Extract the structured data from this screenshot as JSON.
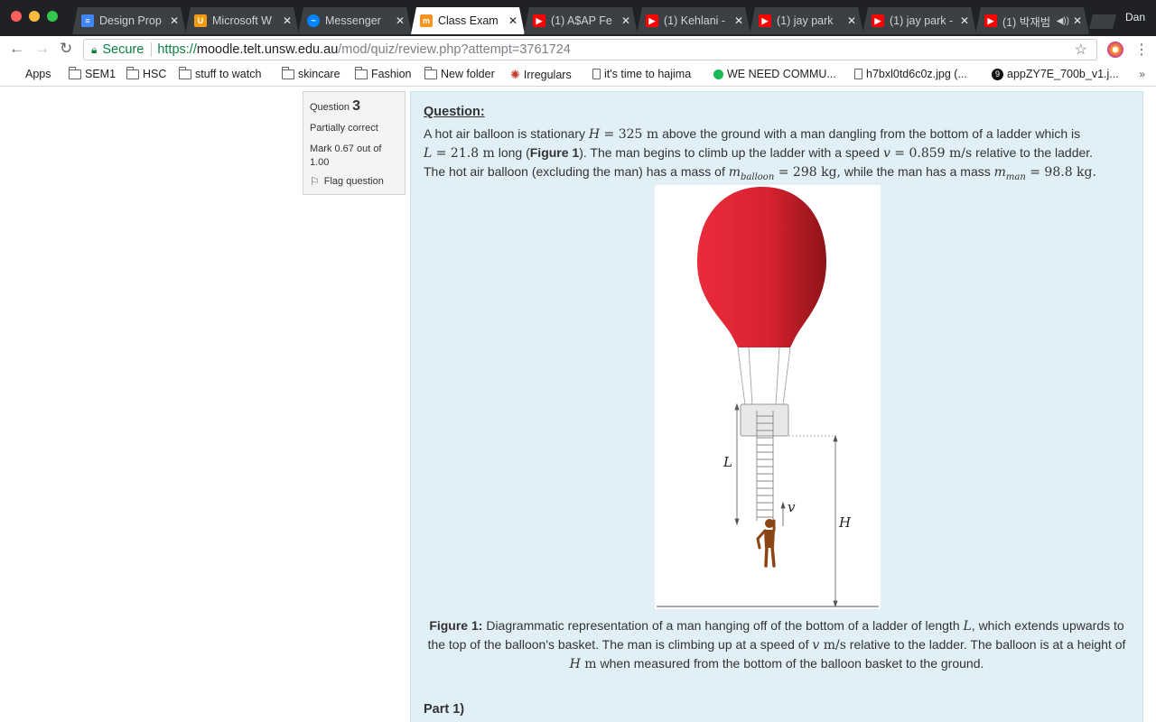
{
  "browser": {
    "tabs": [
      {
        "title": "Design Prop",
        "favicon": "docs-icon",
        "color": "#4285f4",
        "active": false
      },
      {
        "title": "Microsoft W",
        "favicon": "microsoft-icon",
        "color": "#f39c12",
        "active": false
      },
      {
        "title": "Messenger",
        "favicon": "messenger-icon",
        "color": "#0084ff",
        "active": false
      },
      {
        "title": "Class Exam",
        "favicon": "moodle-icon",
        "color": "#f7931e",
        "active": true
      },
      {
        "title": "(1) A$AP Fe",
        "favicon": "youtube-icon",
        "color": "#ff0000",
        "active": false
      },
      {
        "title": "(1) Kehlani -",
        "favicon": "youtube-icon",
        "color": "#ff0000",
        "active": false
      },
      {
        "title": "(1) jay park",
        "favicon": "youtube-icon",
        "color": "#ff0000",
        "active": false
      },
      {
        "title": "(1) jay park -",
        "favicon": "youtube-icon",
        "color": "#ff0000",
        "active": false
      },
      {
        "title": "(1) 박재범",
        "favicon": "youtube-icon",
        "color": "#ff0000",
        "active": false
      }
    ],
    "user": "Dan",
    "secure_label": "Secure",
    "url": {
      "scheme": "https://",
      "host": "moodle.telt.unsw.edu.au",
      "path": "/mod/quiz/review.php?attempt=3761724"
    },
    "bookmarks": [
      {
        "label": "Apps",
        "icon": "apps-grid-icon"
      },
      {
        "label": "SEM1",
        "icon": "folder-icon"
      },
      {
        "label": "HSC",
        "icon": "folder-icon"
      },
      {
        "label": "stuff to watch",
        "icon": "folder-icon"
      },
      {
        "label": "skincare",
        "icon": "folder-icon"
      },
      {
        "label": "Fashion",
        "icon": "folder-icon"
      },
      {
        "label": "New folder",
        "icon": "folder-icon"
      },
      {
        "label": "Irregulars",
        "icon": "irregulars-icon"
      },
      {
        "label": "it's time to hajima",
        "icon": "page-icon"
      },
      {
        "label": "WE NEED COMMU...",
        "icon": "green-dot-icon"
      },
      {
        "label": "h7bxl0td6c0z.jpg (...",
        "icon": "page-icon"
      },
      {
        "label": "appZY7E_700b_v1.j...",
        "icon": "9gag-icon"
      }
    ]
  },
  "question_info": {
    "label": "Question",
    "number": "3",
    "state": "Partially correct",
    "mark": "Mark 0.67 out of 1.00",
    "flag": "Flag question"
  },
  "question": {
    "heading": "Question:",
    "text": {
      "t1": "A hot air balloon is stationary ",
      "H": "H",
      "eq1": " = 325 m",
      "t2": " above the ground with a man dangling from the bottom of a ladder which is",
      "L": "L",
      "eq2": " = 21.8 m",
      "t3": " long (",
      "figref": "Figure 1",
      "t4": "). The man begins to climb up the ladder with a speed ",
      "v": "v",
      "eq3": " = 0.859 m/s",
      "t5": " relative to the ladder.",
      "t6": "The hot air balloon (excluding the man) has a mass of ",
      "mb": "m",
      "mb_sub": "balloon",
      "eq4": " = 298 kg,",
      "t7": " while the man has a mass ",
      "mm": "m",
      "mm_sub": "man",
      "eq5": " = 98.8 kg."
    },
    "figure_labels": {
      "L": "L",
      "v": "v",
      "H": "H"
    },
    "caption": {
      "label": "Figure 1:",
      "c1": " Diagrammatic representation of a man hanging off of the bottom of a ladder of length ",
      "L": "L",
      "c2": ", which extends upwards to the top of the balloon's basket. The man is climbing up at a speed of ",
      "v": "v",
      "unit1": " m/s",
      "c3": " relative to the ladder. The balloon is at a height of ",
      "H": "H",
      "unit2": " m",
      "c4": " when measured from the bottom of the balloon basket to the ground."
    },
    "part": "Part 1)"
  },
  "colors": {
    "balloon": "#d8222f",
    "man": "#8b4513",
    "question_bg": "#e1eff7"
  }
}
